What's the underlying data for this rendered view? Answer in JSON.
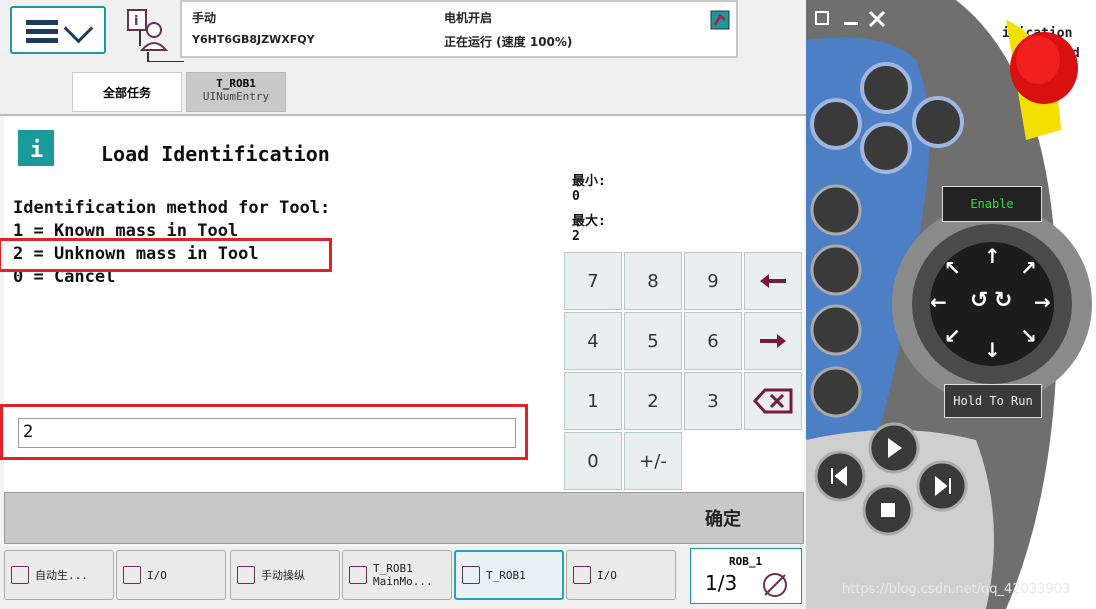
{
  "header": {
    "mode": "手动",
    "system_id": "Y6HT6GB8JZWXFQY",
    "motor": "电机开启",
    "run_state": "正在运行 (速度 100%)"
  },
  "tabs": [
    {
      "label": "全部任务"
    },
    {
      "label": "T_ROB1",
      "sub": "UINumEntry"
    }
  ],
  "dialog": {
    "title": "Load Identification",
    "lines": [
      "Identification method for Tool:",
      "1 = Known mass in Tool",
      "2 = Unknown mass in Tool",
      "0 = Cancel"
    ],
    "min_label": "最小:",
    "min_value": "0",
    "max_label": "最大:",
    "max_value": "2",
    "input_value": "2"
  },
  "keypad": {
    "keys": [
      "7",
      "8",
      "9",
      "4",
      "5",
      "6",
      "1",
      "2",
      "3",
      "0",
      "+/-"
    ]
  },
  "ok_label": "确定",
  "taskbar": [
    {
      "label": "自动生..."
    },
    {
      "label": "I/O"
    },
    {
      "label": "手动操纵"
    },
    {
      "label": "T_ROB1",
      "sub": "MainMo..."
    },
    {
      "label": "T_ROB1"
    },
    {
      "label": "I/O"
    }
  ],
  "robot_indicator": {
    "name": "ROB_1",
    "fraction": "1/3"
  },
  "pendant": {
    "enable_label": "Enable",
    "hold_label": "Hold To Run",
    "bg_text_1": "ification",
    "bg_text_2": "ed",
    "watermark": "https://blog.csdn.net/qq_42033903"
  },
  "colors": {
    "accent": "#1a9a9a",
    "highlight": "#e0232b",
    "pendant_blue": "#4d7fc4",
    "stop_red": "#e01010",
    "stop_yellow": "#f4e000"
  }
}
